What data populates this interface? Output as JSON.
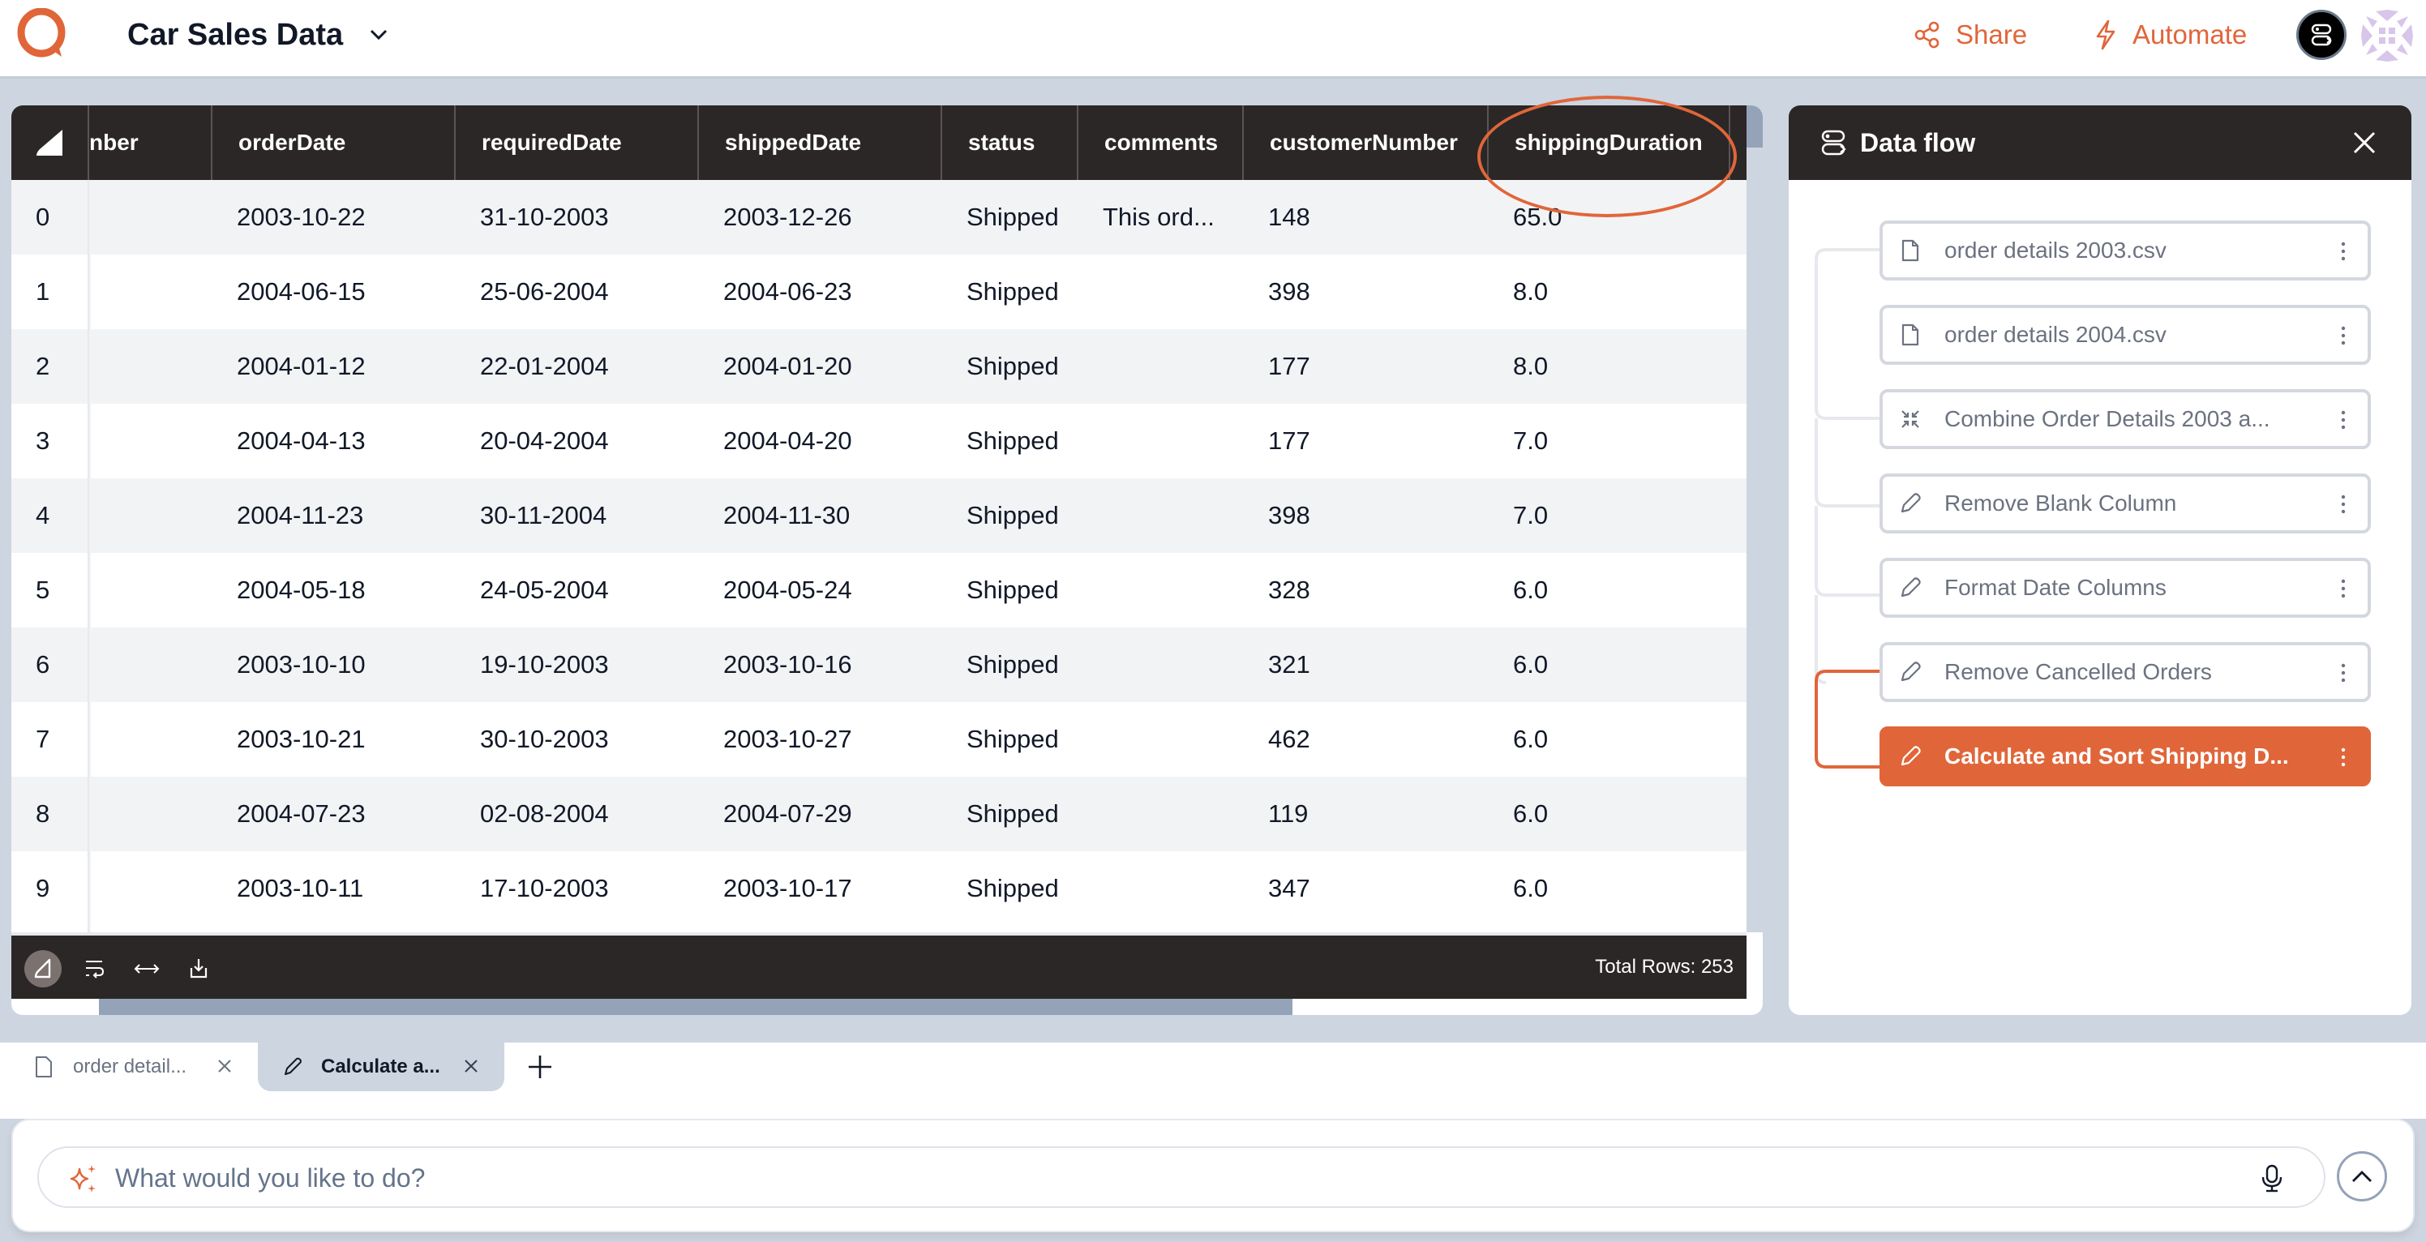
{
  "header": {
    "title": "Car Sales Data",
    "share_label": "Share",
    "automate_label": "Automate",
    "accent_color": "#e0663a"
  },
  "table": {
    "columns": [
      "",
      "nber",
      "orderDate",
      "requiredDate",
      "shippedDate",
      "status",
      "comments",
      "customerNumber",
      "shippingDuration"
    ],
    "rows": [
      {
        "index": "0",
        "nber": "",
        "orderDate": "2003-10-22",
        "requiredDate": "31-10-2003",
        "shippedDate": "2003-12-26",
        "status": "Shipped",
        "comments": "This ord...",
        "customerNumber": "148",
        "shippingDuration": "65.0"
      },
      {
        "index": "1",
        "nber": "",
        "orderDate": "2004-06-15",
        "requiredDate": "25-06-2004",
        "shippedDate": "2004-06-23",
        "status": "Shipped",
        "comments": "",
        "customerNumber": "398",
        "shippingDuration": "8.0"
      },
      {
        "index": "2",
        "nber": "",
        "orderDate": "2004-01-12",
        "requiredDate": "22-01-2004",
        "shippedDate": "2004-01-20",
        "status": "Shipped",
        "comments": "",
        "customerNumber": "177",
        "shippingDuration": "8.0"
      },
      {
        "index": "3",
        "nber": "",
        "orderDate": "2004-04-13",
        "requiredDate": "20-04-2004",
        "shippedDate": "2004-04-20",
        "status": "Shipped",
        "comments": "",
        "customerNumber": "177",
        "shippingDuration": "7.0"
      },
      {
        "index": "4",
        "nber": "",
        "orderDate": "2004-11-23",
        "requiredDate": "30-11-2004",
        "shippedDate": "2004-11-30",
        "status": "Shipped",
        "comments": "",
        "customerNumber": "398",
        "shippingDuration": "7.0"
      },
      {
        "index": "5",
        "nber": "",
        "orderDate": "2004-05-18",
        "requiredDate": "24-05-2004",
        "shippedDate": "2004-05-24",
        "status": "Shipped",
        "comments": "",
        "customerNumber": "328",
        "shippingDuration": "6.0"
      },
      {
        "index": "6",
        "nber": "",
        "orderDate": "2003-10-10",
        "requiredDate": "19-10-2003",
        "shippedDate": "2003-10-16",
        "status": "Shipped",
        "comments": "",
        "customerNumber": "321",
        "shippingDuration": "6.0"
      },
      {
        "index": "7",
        "nber": "",
        "orderDate": "2003-10-21",
        "requiredDate": "30-10-2003",
        "shippedDate": "2003-10-27",
        "status": "Shipped",
        "comments": "",
        "customerNumber": "462",
        "shippingDuration": "6.0"
      },
      {
        "index": "8",
        "nber": "",
        "orderDate": "2004-07-23",
        "requiredDate": "02-08-2004",
        "shippedDate": "2004-07-29",
        "status": "Shipped",
        "comments": "",
        "customerNumber": "119",
        "shippingDuration": "6.0"
      },
      {
        "index": "9",
        "nber": "",
        "orderDate": "2003-10-11",
        "requiredDate": "17-10-2003",
        "shippedDate": "2003-10-17",
        "status": "Shipped",
        "comments": "",
        "customerNumber": "347",
        "shippingDuration": "6.0"
      }
    ],
    "total_rows_label": "Total Rows: 253",
    "highlighted_column": "shippingDuration"
  },
  "dataflow": {
    "title": "Data flow",
    "steps": [
      {
        "label": "order details 2003.csv",
        "icon": "file-icon",
        "active": false
      },
      {
        "label": "order details 2004.csv",
        "icon": "file-icon",
        "active": false
      },
      {
        "label": "Combine Order Details 2003 a...",
        "icon": "combine-icon",
        "active": false
      },
      {
        "label": "Remove Blank Column",
        "icon": "pencil-icon",
        "active": false
      },
      {
        "label": "Format Date Columns",
        "icon": "pencil-icon",
        "active": false
      },
      {
        "label": "Remove Cancelled Orders",
        "icon": "pencil-icon",
        "active": false
      },
      {
        "label": "Calculate and Sort Shipping D...",
        "icon": "pencil-icon",
        "active": true
      }
    ]
  },
  "tabs": [
    {
      "label": "order detail...",
      "icon": "file-icon",
      "active": false
    },
    {
      "label": "Calculate a...",
      "icon": "pencil-icon",
      "active": true
    }
  ],
  "prompt": {
    "placeholder": "What would you like to do?",
    "value": ""
  }
}
